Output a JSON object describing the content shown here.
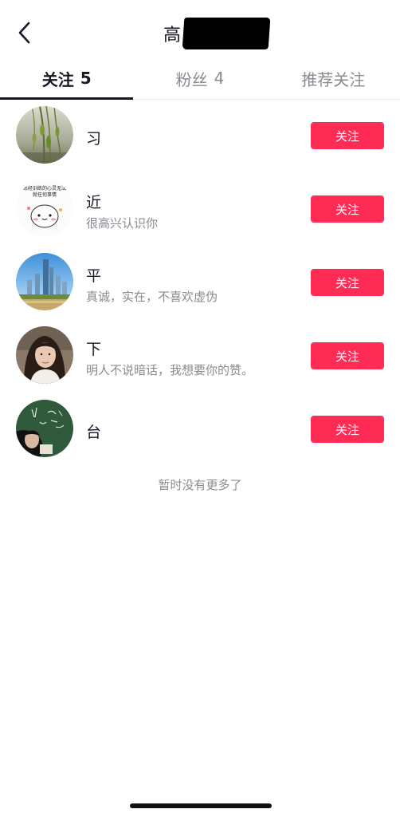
{
  "header": {
    "title": "高",
    "back_icon": "chevron-left-icon"
  },
  "tabs": [
    {
      "label": "关注",
      "count": "5",
      "active": true
    },
    {
      "label": "粉丝",
      "count": "4",
      "active": false
    },
    {
      "label": "推荐关注",
      "count": "",
      "active": false
    }
  ],
  "users": [
    {
      "name": "习",
      "bio": "",
      "follow_label": "关注",
      "avatar": "willow-branches"
    },
    {
      "name": "近",
      "bio": "很高兴认识你",
      "follow_label": "关注",
      "avatar": "cartoon-sticker-with-text"
    },
    {
      "name": "平",
      "bio": "真诚，实在，不喜欢虚伪",
      "follow_label": "关注",
      "avatar": "city-skyline"
    },
    {
      "name": "下",
      "bio": "明人不说暗话，我想要你的赞。",
      "follow_label": "关注",
      "avatar": "woman-portrait"
    },
    {
      "name": "台",
      "bio": "",
      "follow_label": "关注",
      "avatar": "chalkboard-doodle"
    }
  ],
  "avatar_sticker_text": [
    "练经训练的心灵无法",
    "就任何事情"
  ],
  "footer": {
    "no_more_text": "暂时没有更多了"
  },
  "colors": {
    "accent": "#fe2c55",
    "text_primary": "#161823",
    "text_secondary": "#8a8b91"
  }
}
